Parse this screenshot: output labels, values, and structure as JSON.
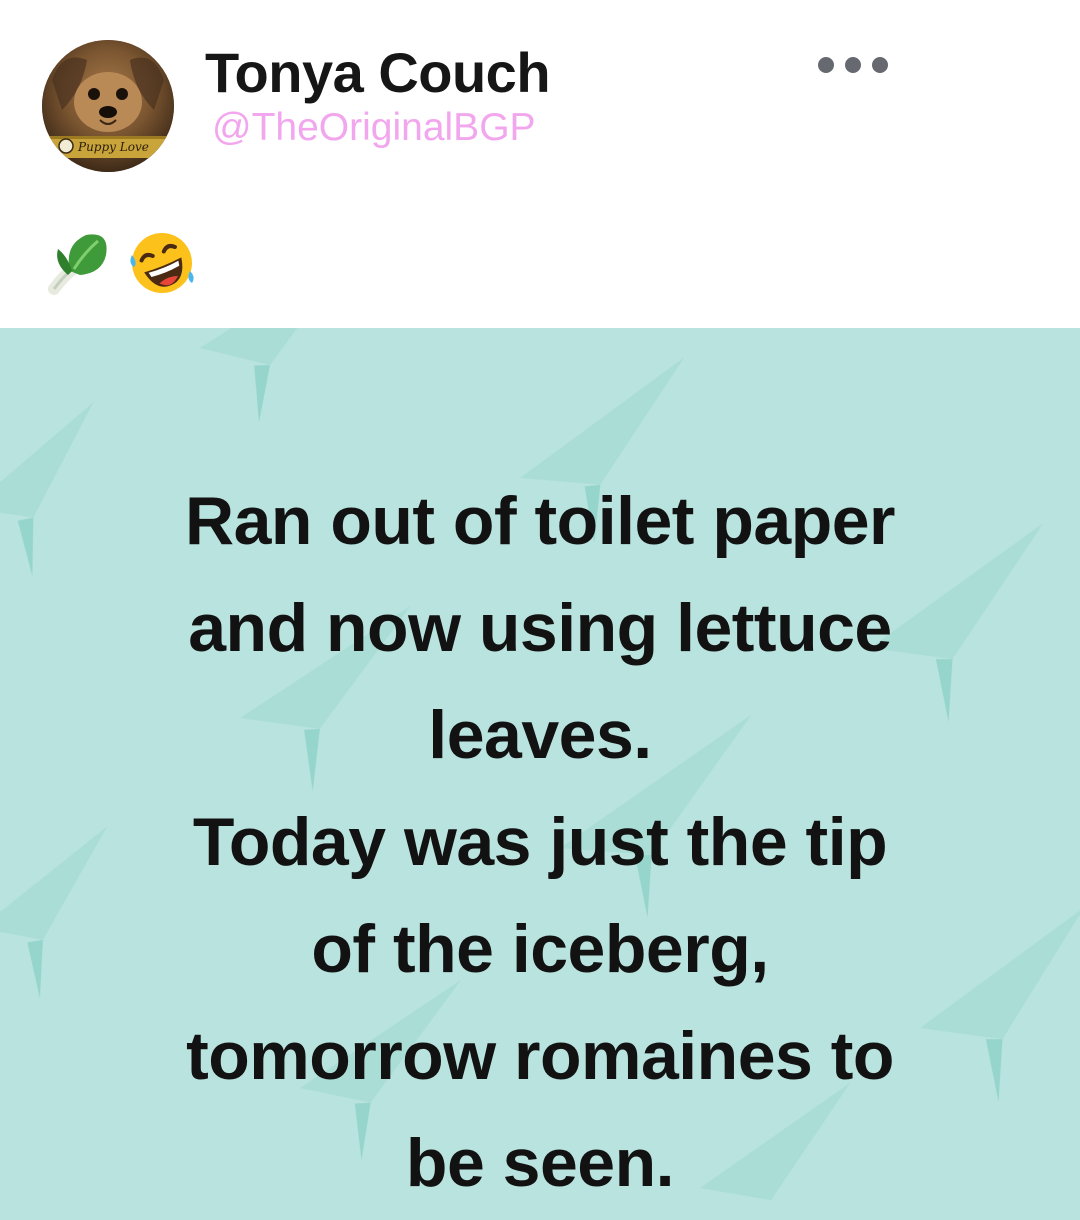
{
  "post": {
    "author": {
      "display_name": "Tonya Couch",
      "handle": "@TheOriginalBGP",
      "avatar_collar_text": "Puppy Love"
    },
    "more_menu_icon": "more-horizontal-icon",
    "emojis": [
      {
        "name": "leafy-green-icon"
      },
      {
        "name": "rolling-on-floor-laughing-icon"
      }
    ]
  },
  "meme": {
    "background_color": "#b9e3df",
    "text_color": "#121212",
    "lines": [
      "Ran out of toilet paper",
      "and now using lettuce",
      "leaves.",
      "Today was just the tip",
      "of the iceberg,",
      "tomorrow romaines to",
      "be seen."
    ]
  }
}
